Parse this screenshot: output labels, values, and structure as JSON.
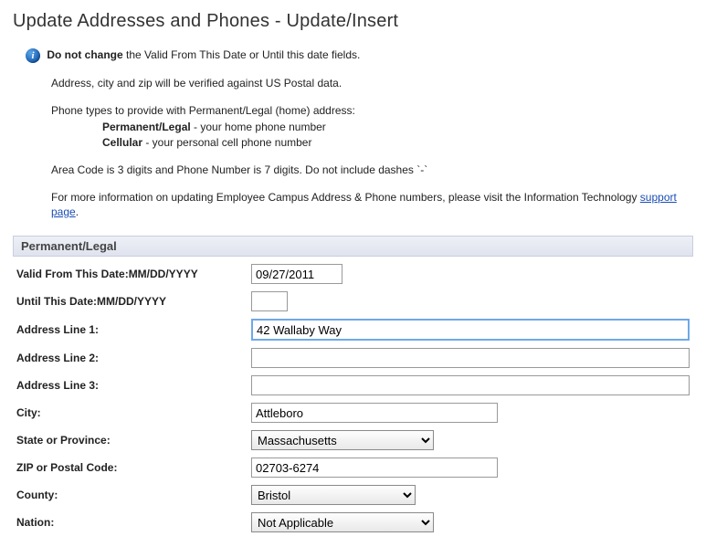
{
  "page": {
    "title": "Update Addresses and Phones - Update/Insert"
  },
  "info": {
    "bold_lead": "Do not change",
    "lead_rest": " the Valid From This Date or Until this date fields.",
    "verify": "Address, city and zip will be verified against US Postal data.",
    "phone_intro": "Phone types to provide with Permanent/Legal (home) address:",
    "perm_bold": "Permanent/Legal",
    "perm_rest": " - your home phone number",
    "cell_bold": "Cellular",
    "cell_rest": " - your personal cell phone number",
    "area_code": "Area Code is 3 digits and Phone Number is 7 digits. Do not include dashes `-`",
    "more_info_pre": "For more information on updating Employee Campus Address & Phone numbers, please visit the Information Technology ",
    "support_link": "support page",
    "more_info_post": "."
  },
  "section": {
    "title": "Permanent/Legal"
  },
  "form": {
    "valid_from_label": "Valid From This Date:MM/DD/YYYY",
    "valid_from_value": "09/27/2011",
    "until_label": "Until This Date:MM/DD/YYYY",
    "until_value": "",
    "addr1_label": "Address Line 1:",
    "addr1_value": "42 Wallaby Way",
    "addr2_label": "Address Line 2:",
    "addr2_value": "",
    "addr3_label": "Address Line 3:",
    "addr3_value": "",
    "city_label": "City:",
    "city_value": "Attleboro",
    "state_label": "State or Province:",
    "state_value": "Massachusetts",
    "zip_label": "ZIP or Postal Code:",
    "zip_value": "02703-6274",
    "county_label": "County:",
    "county_value": "Bristol",
    "nation_label": "Nation:",
    "nation_value": "Not Applicable"
  }
}
